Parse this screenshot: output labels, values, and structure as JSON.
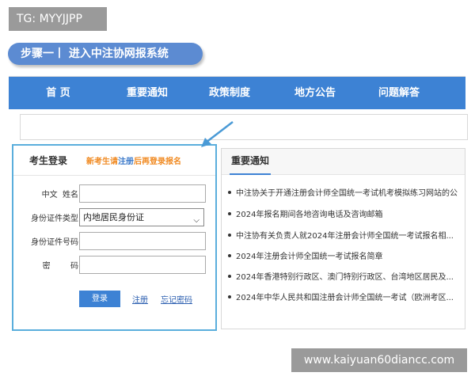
{
  "tag": "TG: MYYJJPP",
  "step": "步骤一丨 进入中注协网报系统",
  "nav": {
    "items": [
      "首 页",
      "重要通知",
      "政策制度",
      "地方公告",
      "问题解答"
    ],
    "bg_color": "#3d82d4"
  },
  "login": {
    "title": "考生登录",
    "hint_prefix": "新考生请",
    "hint_link": "注册",
    "hint_suffix": "后再登录报名",
    "fields": {
      "name_label": "中文  姓名",
      "id_type_label": "身份证件类型",
      "id_type_value": "内地居民身份证",
      "id_number_label": "身份证件号码",
      "password_label": "密        码"
    },
    "login_button": "登录",
    "register_link": "注册",
    "forgot_link": "忘记密码"
  },
  "notices": {
    "title": "重要通知",
    "items": [
      "中注协关于开通注册会计师全国统一考试机考模拟练习网站的公",
      "2024年报名期间各地咨询电话及咨询邮箱",
      "中注协有关负责人就2024年注册会计师全国统一考试报名相...",
      "2024年注册会计师全国统一考试报名简章",
      "2024年香港特别行政区、澳门特别行政区、台湾地区居民及...",
      "2024年中华人民共和国注册会计师全国统一考试（欧洲考区..."
    ]
  },
  "watermark": "www.kaiyuan60diancc.com"
}
